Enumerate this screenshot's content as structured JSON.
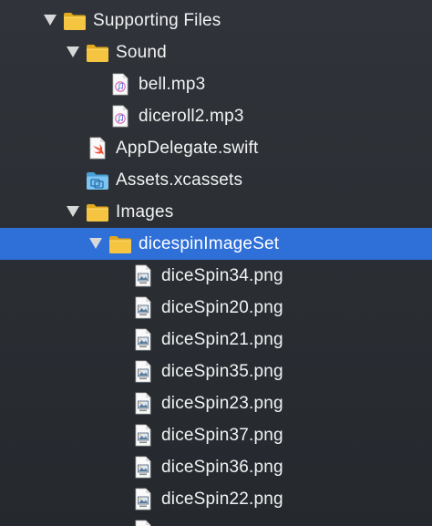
{
  "colors": {
    "background": "#2b2f34",
    "selection": "#2e6fd8",
    "folder": "#f5c542",
    "text": "#f2f2f2"
  },
  "tree": [
    {
      "label": "Supporting Files",
      "type": "folder",
      "icon": "folder-icon",
      "level": 0,
      "disclosure": "expanded"
    },
    {
      "label": "Sound",
      "type": "folder",
      "icon": "folder-icon",
      "level": 1,
      "disclosure": "expanded"
    },
    {
      "label": "bell.mp3",
      "type": "file",
      "icon": "audio-file-icon",
      "level": 2
    },
    {
      "label": "diceroll2.mp3",
      "type": "file",
      "icon": "audio-file-icon",
      "level": 2
    },
    {
      "label": "AppDelegate.swift",
      "type": "file",
      "icon": "swift-file-icon",
      "level": 1
    },
    {
      "label": "Assets.xcassets",
      "type": "folder",
      "icon": "asset-catalog-icon",
      "level": 1
    },
    {
      "label": "Images",
      "type": "folder",
      "icon": "folder-icon",
      "level": 1,
      "disclosure": "expanded"
    },
    {
      "label": "dicespinImageSet",
      "type": "folder",
      "icon": "folder-icon",
      "level": 2,
      "disclosure": "expanded",
      "selected": true
    },
    {
      "label": "diceSpin34.png",
      "type": "file",
      "icon": "image-file-icon",
      "level": 3
    },
    {
      "label": "diceSpin20.png",
      "type": "file",
      "icon": "image-file-icon",
      "level": 3
    },
    {
      "label": "diceSpin21.png",
      "type": "file",
      "icon": "image-file-icon",
      "level": 3
    },
    {
      "label": "diceSpin35.png",
      "type": "file",
      "icon": "image-file-icon",
      "level": 3
    },
    {
      "label": "diceSpin23.png",
      "type": "file",
      "icon": "image-file-icon",
      "level": 3
    },
    {
      "label": "diceSpin37.png",
      "type": "file",
      "icon": "image-file-icon",
      "level": 3
    },
    {
      "label": "diceSpin36.png",
      "type": "file",
      "icon": "image-file-icon",
      "level": 3
    },
    {
      "label": "diceSpin22.png",
      "type": "file",
      "icon": "image-file-icon",
      "level": 3
    },
    {
      "label": "",
      "type": "file",
      "icon": "image-file-icon",
      "level": 3
    }
  ]
}
